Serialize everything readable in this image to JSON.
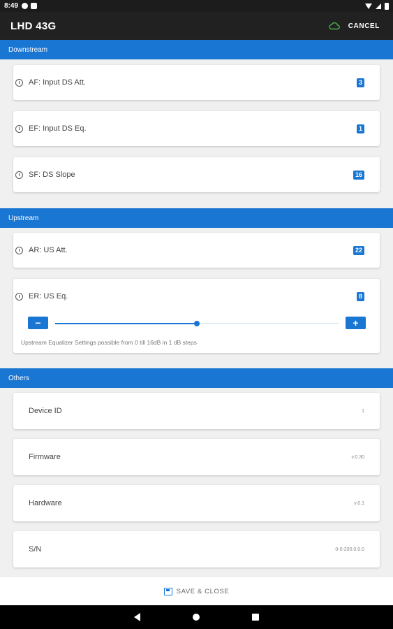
{
  "status_bar": {
    "time": "8:49"
  },
  "app_bar": {
    "title": "LHD 43G",
    "cancel_label": "CANCEL"
  },
  "sections": {
    "downstream": {
      "header": "Downstream",
      "items": [
        {
          "label": "AF: Input DS Att.",
          "value": "3"
        },
        {
          "label": "EF: Input DS Eq.",
          "value": "1"
        },
        {
          "label": "SF: DS Slope",
          "value": "16"
        }
      ]
    },
    "upstream": {
      "header": "Upstream",
      "items": [
        {
          "label": "AR: US Att.",
          "value": "22"
        },
        {
          "label": "ER: US Eq.",
          "value": "8"
        }
      ],
      "slider": {
        "min": 0,
        "max": 16,
        "value": 8,
        "minus_label": "−",
        "plus_label": "+",
        "hint": "Upstream Equalizer Settings possible from 0 till 16dB in 1 dB steps"
      }
    },
    "others": {
      "header": "Others",
      "items": [
        {
          "label": "Device ID",
          "value": "1"
        },
        {
          "label": "Firmware",
          "value": "v.0.30"
        },
        {
          "label": "Hardware",
          "value": "v.0.1"
        },
        {
          "label": "S/N",
          "value": "0-0-200.0.0.0"
        }
      ]
    }
  },
  "bottom_bar": {
    "save_label": "SAVE & CLOSE"
  },
  "colors": {
    "accent": "#1976d2",
    "app_bar": "#212121",
    "cloud_icon": "#4caf50"
  }
}
